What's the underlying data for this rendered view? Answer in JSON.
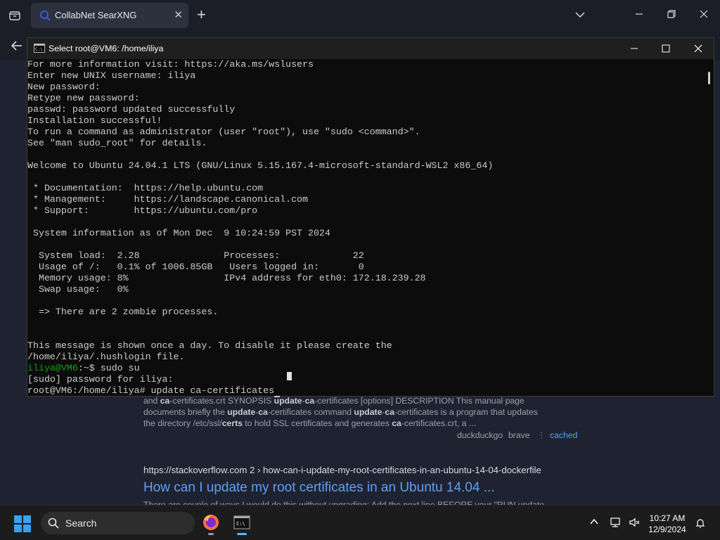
{
  "browser": {
    "tab_title": "CollabNet SearXNG"
  },
  "page": {
    "snippet_lines": [
      {
        "parts": [
          [
            "and ",
            0
          ],
          [
            "ca",
            1
          ],
          [
            "-certificates.crt SYNOPSIS ",
            0
          ],
          [
            "update",
            1
          ],
          [
            "-",
            0
          ],
          [
            "ca",
            1
          ],
          [
            "-certificates [options] DESCRIPTION This manual page",
            0
          ]
        ]
      },
      {
        "parts": [
          [
            "documents briefly the ",
            0
          ],
          [
            "update",
            1
          ],
          [
            "-",
            0
          ],
          [
            "ca",
            1
          ],
          [
            "-certificates command ",
            0
          ],
          [
            "update",
            1
          ],
          [
            "-",
            0
          ],
          [
            "ca",
            1
          ],
          [
            "-certificates is a program that updates",
            0
          ]
        ]
      },
      {
        "parts": [
          [
            "the directory /etc/ssl/",
            0
          ],
          [
            "certs",
            1
          ],
          [
            " to hold SSL certificates and generates ",
            0
          ],
          [
            "ca",
            1
          ],
          [
            "-certificates.crt, a ...",
            0
          ]
        ]
      }
    ],
    "meta_engines": "duckduckgo",
    "meta_engine2": "brave",
    "meta_sep": "⋮",
    "meta_cached": "cached",
    "result_url": "https://stackoverflow.com  2 › how-can-i-update-my-root-certificates-in-an-ubuntu-14-04-dockerfile",
    "result_title": "How can I update my root certificates in an Ubuntu 14.04 ...",
    "result_snippet": "There are couple of ways I would do this without upgrading: Add the next line BEFORE your \"RUN update"
  },
  "terminal": {
    "title": "Select root@VM6: /home/iliya",
    "lines": [
      "For more information visit: https://aka.ms/wslusers",
      "Enter new UNIX username: iliya",
      "New password:",
      "Retype new password:",
      "passwd: password updated successfully",
      "Installation successful!",
      "To run a command as administrator (user \"root\"), use \"sudo <command>\".",
      "See \"man sudo_root\" for details.",
      "",
      "Welcome to Ubuntu 24.04.1 LTS (GNU/Linux 5.15.167.4-microsoft-standard-WSL2 x86_64)",
      "",
      " * Documentation:  https://help.ubuntu.com",
      " * Management:     https://landscape.canonical.com",
      " * Support:        https://ubuntu.com/pro",
      "",
      " System information as of Mon Dec  9 10:24:59 PST 2024",
      "",
      "  System load:  2.28               Processes:             22",
      "  Usage of /:   0.1% of 1006.85GB   Users logged in:       0",
      "  Memory usage: 8%                 IPv4 address for eth0: 172.18.239.28",
      "  Swap usage:   0%",
      "",
      "  => There are 2 zombie processes.",
      "",
      "",
      "This message is shown once a day. To disable it please create the",
      "/home/iliya/.hushlogin file."
    ],
    "prompt_user": "iliya@VM6",
    "prompt_rest": ":~$ sudo su",
    "sudo_line": "[sudo] password for iliya:",
    "root_line": "root@VM6:/home/iliya# update ca-certificates"
  },
  "taskbar": {
    "search_label": "Search",
    "time": "10:27 AM",
    "date": "12/9/2024"
  }
}
